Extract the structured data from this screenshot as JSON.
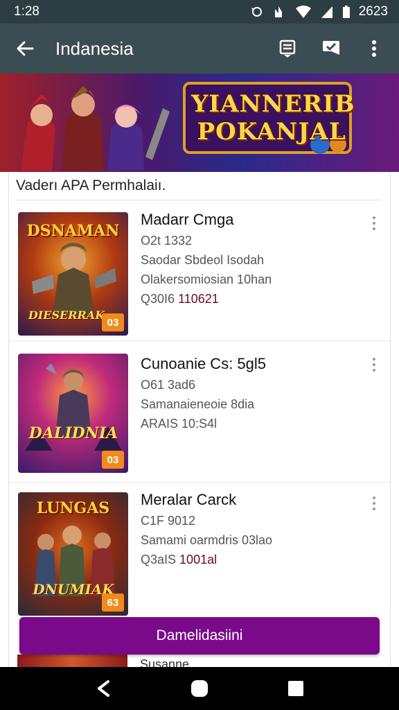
{
  "status_bar": {
    "time": "1:28",
    "battery_text": "2623"
  },
  "app_bar": {
    "title": "Indanesia",
    "icons": [
      "back-arrow-icon",
      "list-icon",
      "message-check-icon",
      "more-vert-icon"
    ]
  },
  "banner": {
    "title_line1": "YIANNERIB",
    "title_line2": "POKANJAL"
  },
  "section": {
    "header": "Vaderı APA Permhalaiı."
  },
  "items": [
    {
      "thumb_title": "DSNAMAN",
      "thumb_subtitle": "DIESERRAK",
      "badge": "03",
      "name": "Madarr Cmga",
      "line1": "O2t 1332",
      "line2": "Saodar Sbdeol Isodah",
      "line3": "Olakersomiosian 10han",
      "line4_prefix": "Q30I6",
      "line4_accent": "110621"
    },
    {
      "thumb_title": "",
      "thumb_subtitle": "DALIDNIA",
      "badge": "03",
      "name": "Cunoanie Cs: 5gl5",
      "line1": "O61 3ad6",
      "line2": "Samanaieneoie 8dia",
      "line3": "ARAIS  10:S4l",
      "line4_prefix": "",
      "line4_accent": ""
    },
    {
      "thumb_title": "LUNGAS",
      "thumb_subtitle": "DNUMIAK",
      "badge": "63",
      "name": "Meralar Carck",
      "line1": "C1F 9012",
      "line2": "Samami oarmdris 03lao",
      "line3": "",
      "line4_prefix": "Q3aIS",
      "line4_accent": "1001al"
    }
  ],
  "cta": {
    "label": "Damelidasiini"
  },
  "partial_item": {
    "text": "Susanne"
  },
  "colors": {
    "status_bar": "#2c3e44",
    "app_bar": "#3a4d53",
    "cta": "#7a0a8a",
    "badge": "#f08a1a",
    "accent_text": "#6a0a2a"
  }
}
